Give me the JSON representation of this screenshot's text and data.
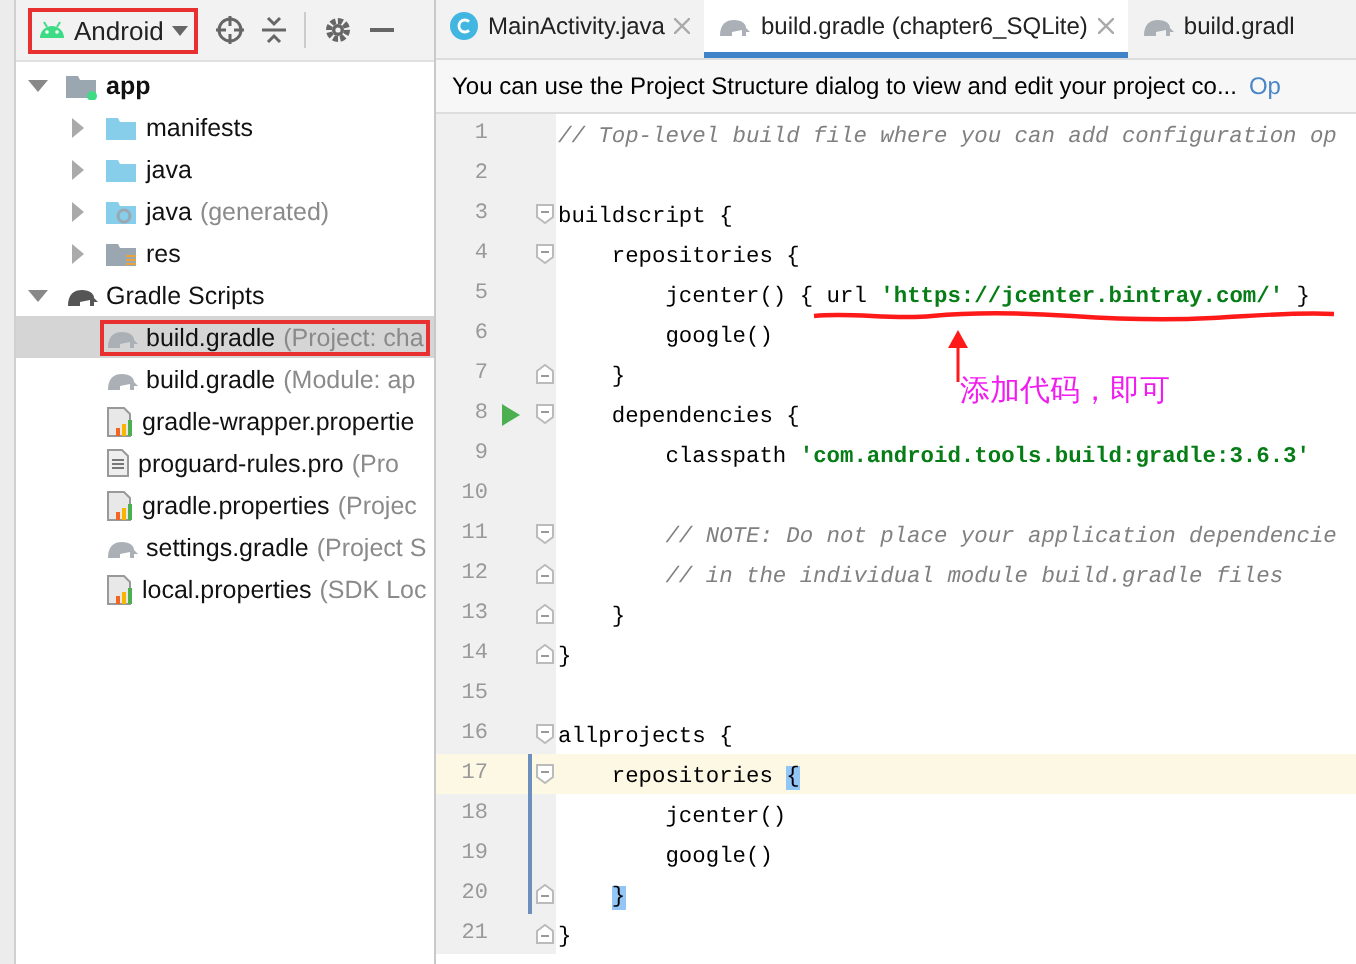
{
  "project_panel": {
    "view_selector": {
      "label": "Android",
      "annotated": true
    },
    "tree": [
      {
        "label": "app",
        "kind": "module",
        "expanded": true,
        "selected": false,
        "annotated": false,
        "children": [
          {
            "label": "manifests",
            "kind": "folder",
            "expanded": false,
            "selected": false,
            "annotated": false
          },
          {
            "label": "java",
            "kind": "folder",
            "expanded": false,
            "selected": false,
            "annotated": false
          },
          {
            "label": "java",
            "detail": "(generated)",
            "kind": "generated",
            "expanded": false,
            "selected": false,
            "annotated": false
          },
          {
            "label": "res",
            "kind": "res",
            "expanded": false,
            "selected": false,
            "annotated": false
          }
        ]
      },
      {
        "label": "Gradle Scripts",
        "kind": "gradle",
        "expanded": true,
        "selected": false,
        "annotated": false,
        "children": [
          {
            "label": "build.gradle",
            "detail": "(Project: cha",
            "kind": "gradle",
            "selected": true,
            "annotated": true
          },
          {
            "label": "build.gradle",
            "detail": "(Module: ap",
            "kind": "gradle",
            "selected": false,
            "annotated": false
          },
          {
            "label": "gradle-wrapper.propertie",
            "kind": "properties",
            "selected": false,
            "annotated": false
          },
          {
            "label": "proguard-rules.pro",
            "detail": "(Pro",
            "kind": "file",
            "selected": false,
            "annotated": false
          },
          {
            "label": "gradle.properties",
            "detail": "(Projec",
            "kind": "properties",
            "selected": false,
            "annotated": false
          },
          {
            "label": "settings.gradle",
            "detail": "(Project S",
            "kind": "gradle",
            "selected": false,
            "annotated": false
          },
          {
            "label": "local.properties",
            "detail": "(SDK Loc",
            "kind": "properties",
            "selected": false,
            "annotated": false
          }
        ]
      }
    ]
  },
  "editor": {
    "tabs": [
      {
        "label": "MainActivity.java",
        "kind": "java",
        "selected": false,
        "closable": true
      },
      {
        "label": "build.gradle (chapter6_SQLite)",
        "kind": "gradle",
        "selected": true,
        "closable": true
      },
      {
        "label": "build.gradl",
        "kind": "gradle",
        "selected": false,
        "closable": false
      }
    ],
    "banner": {
      "text": "You can use the Project Structure dialog to view and edit your project co...",
      "link": "Op"
    },
    "lines": [
      {
        "number": "1",
        "fold_start": false,
        "fold_end": false,
        "run": false,
        "current": false,
        "changed": false,
        "tokens": [
          {
            "kind": "comment",
            "text": "// Top-level build file where you can add configuration op"
          }
        ]
      },
      {
        "number": "2",
        "fold_start": false,
        "fold_end": false,
        "run": false,
        "current": false,
        "changed": false
      },
      {
        "number": "3",
        "fold_start": true,
        "fold_end": false,
        "run": false,
        "current": false,
        "changed": false,
        "tokens": [
          {
            "kind": "plain",
            "text": "buildscript {"
          }
        ]
      },
      {
        "number": "4",
        "fold_start": true,
        "fold_end": false,
        "run": false,
        "current": false,
        "changed": false,
        "tokens": [
          {
            "kind": "plain",
            "text": "    repositories {"
          }
        ]
      },
      {
        "number": "5",
        "fold_start": false,
        "fold_end": false,
        "run": false,
        "current": false,
        "changed": false,
        "tokens": [
          {
            "kind": "plain",
            "text": "        jcenter() { url "
          },
          {
            "kind": "string",
            "text": "'https://jcenter.bintray.com/'"
          },
          {
            "kind": "plain",
            "text": " }"
          }
        ]
      },
      {
        "number": "6",
        "fold_start": false,
        "fold_end": false,
        "run": false,
        "current": false,
        "changed": false,
        "tokens": [
          {
            "kind": "plain",
            "text": "        google()"
          }
        ]
      },
      {
        "number": "7",
        "fold_start": false,
        "fold_end": true,
        "run": false,
        "current": false,
        "changed": false,
        "tokens": [
          {
            "kind": "plain",
            "text": "    }"
          }
        ]
      },
      {
        "number": "8",
        "fold_start": true,
        "fold_end": false,
        "run": true,
        "current": false,
        "changed": false,
        "tokens": [
          {
            "kind": "plain",
            "text": "    dependencies {"
          }
        ]
      },
      {
        "number": "9",
        "fold_start": false,
        "fold_end": false,
        "run": false,
        "current": false,
        "changed": false,
        "tokens": [
          {
            "kind": "plain",
            "text": "        classpath "
          },
          {
            "kind": "string",
            "text": "'com.android.tools.build:gradle:3.6.3'"
          }
        ]
      },
      {
        "number": "10",
        "fold_start": false,
        "fold_end": false,
        "run": false,
        "current": false,
        "changed": false
      },
      {
        "number": "11",
        "fold_start": true,
        "fold_end": false,
        "run": false,
        "current": false,
        "changed": false,
        "tokens": [
          {
            "kind": "comment",
            "text": "        // NOTE: Do not place your application dependencie"
          }
        ]
      },
      {
        "number": "12",
        "fold_start": false,
        "fold_end": true,
        "run": false,
        "current": false,
        "changed": false,
        "tokens": [
          {
            "kind": "comment",
            "text": "        // in the individual module build.gradle files"
          }
        ]
      },
      {
        "number": "13",
        "fold_start": false,
        "fold_end": true,
        "run": false,
        "current": false,
        "changed": false,
        "tokens": [
          {
            "kind": "plain",
            "text": "    }"
          }
        ]
      },
      {
        "number": "14",
        "fold_start": false,
        "fold_end": true,
        "run": false,
        "current": false,
        "changed": false,
        "tokens": [
          {
            "kind": "plain",
            "text": "}"
          }
        ]
      },
      {
        "number": "15",
        "fold_start": false,
        "fold_end": false,
        "run": false,
        "current": false,
        "changed": false
      },
      {
        "number": "16",
        "fold_start": true,
        "fold_end": false,
        "run": false,
        "current": false,
        "changed": false,
        "tokens": [
          {
            "kind": "plain",
            "text": "allprojects {"
          }
        ]
      },
      {
        "number": "17",
        "fold_start": true,
        "fold_end": false,
        "run": false,
        "current": true,
        "changed": true,
        "tokens": [
          {
            "kind": "plain",
            "text": "    repositories "
          },
          {
            "kind": "match",
            "text": "{"
          }
        ]
      },
      {
        "number": "18",
        "fold_start": false,
        "fold_end": false,
        "run": false,
        "current": false,
        "changed": true,
        "tokens": [
          {
            "kind": "plain",
            "text": "        jcenter()"
          }
        ]
      },
      {
        "number": "19",
        "fold_start": false,
        "fold_end": false,
        "run": false,
        "current": false,
        "changed": true,
        "tokens": [
          {
            "kind": "plain",
            "text": "        google()"
          }
        ]
      },
      {
        "number": "20",
        "fold_start": false,
        "fold_end": true,
        "run": false,
        "current": false,
        "changed": true,
        "tokens": [
          {
            "kind": "match",
            "text": "    }"
          }
        ]
      },
      {
        "number": "21",
        "fold_start": false,
        "fold_end": true,
        "run": false,
        "current": false,
        "changed": false,
        "tokens": [
          {
            "kind": "plain",
            "text": "}"
          }
        ]
      }
    ],
    "annotation": {
      "text": "添加代码，即可"
    }
  }
}
